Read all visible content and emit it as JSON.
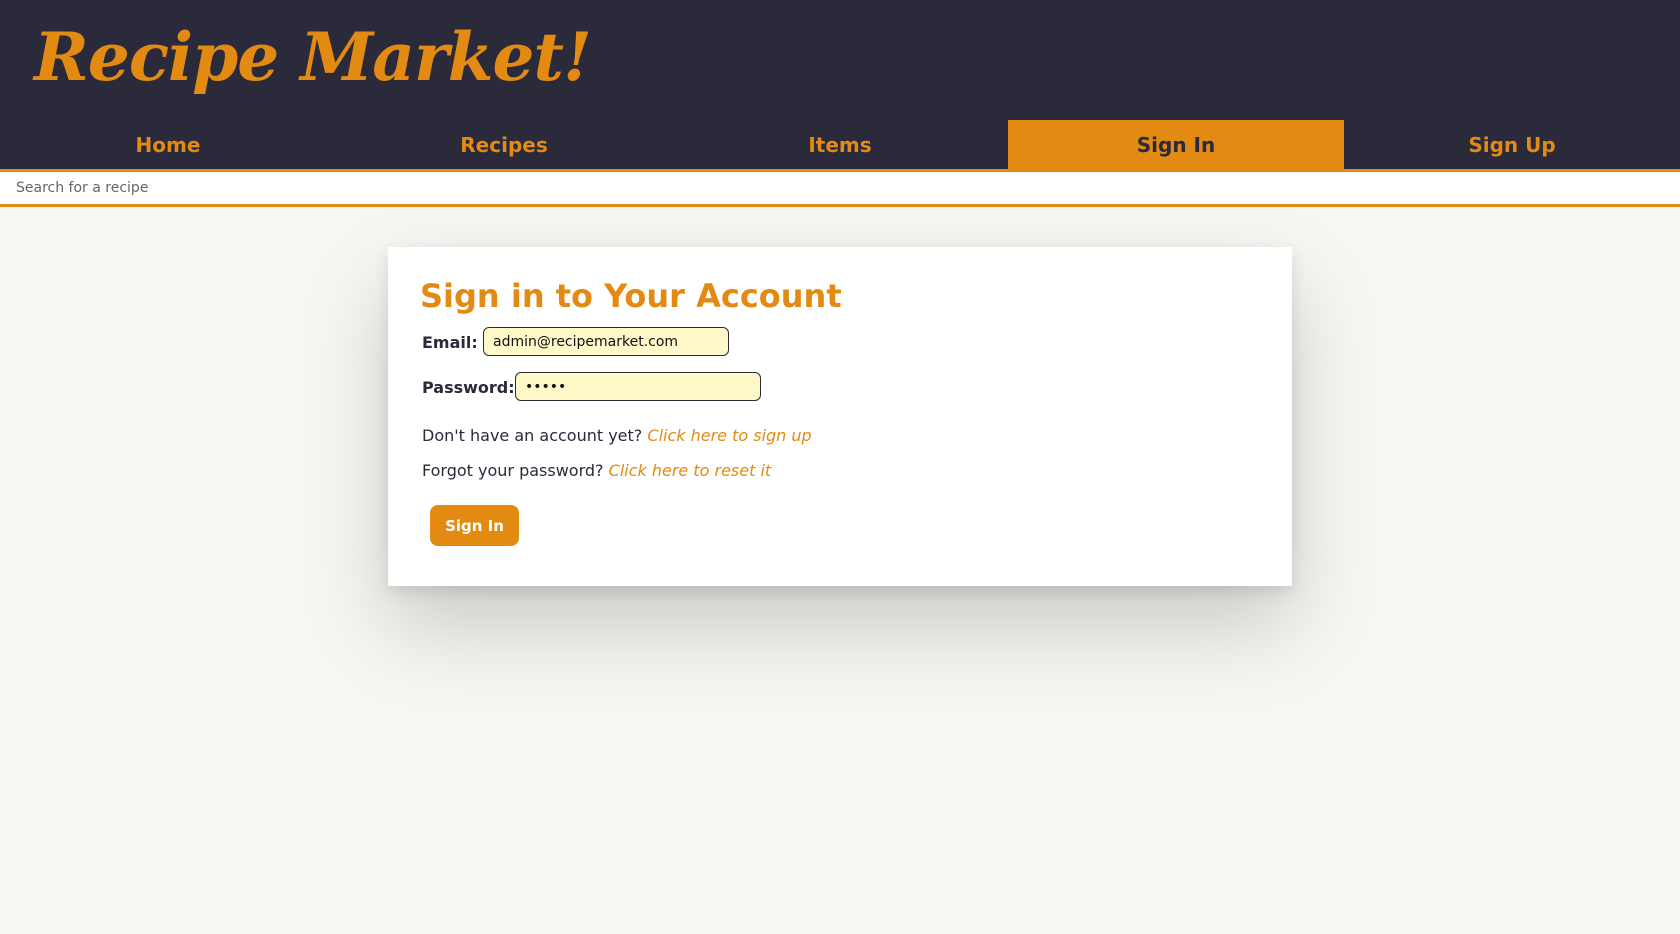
{
  "header": {
    "logo": "Recipe Market!"
  },
  "nav": {
    "items": [
      {
        "label": "Home"
      },
      {
        "label": "Recipes"
      },
      {
        "label": "Items"
      },
      {
        "label": "Sign In"
      },
      {
        "label": "Sign Up"
      }
    ],
    "active_index": 3
  },
  "search": {
    "placeholder": "Search for a recipe",
    "value": ""
  },
  "signin": {
    "title": "Sign in to Your Account",
    "email_label": "Email:",
    "email_value": "admin@recipemarket.com",
    "password_label": "Password:",
    "password_value": "•••••",
    "signup_prompt": "Don't have an account yet?",
    "signup_link": "Click here to sign up",
    "reset_prompt": "Forgot your password?",
    "reset_link": "Click here to reset it",
    "submit_label": "Sign In"
  },
  "colors": {
    "accent": "#e38a12",
    "header_bg": "#2a2a3a",
    "page_bg": "#f5f7f2",
    "input_bg": "#fff9c9"
  }
}
